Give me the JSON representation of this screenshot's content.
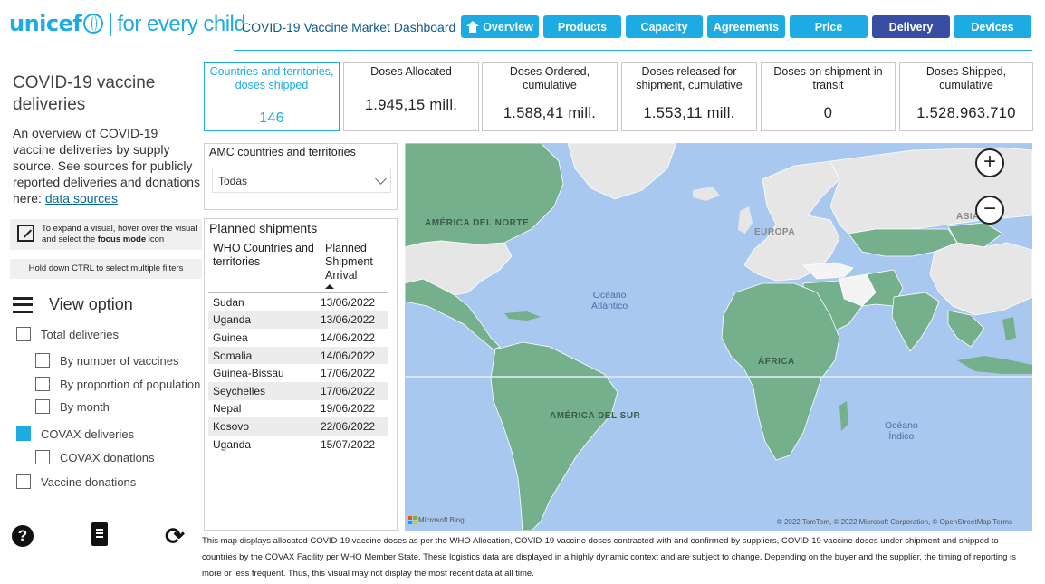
{
  "header": {
    "brand": "unicef",
    "tagline": "for every child",
    "dashboard_title": "COVID-19 Vaccine Market Dashboard",
    "nav": [
      {
        "label": "Overview",
        "active": false
      },
      {
        "label": "Products",
        "active": false
      },
      {
        "label": "Capacity",
        "active": false
      },
      {
        "label": "Agreements",
        "active": false
      },
      {
        "label": "Price",
        "active": false
      },
      {
        "label": "Delivery",
        "active": true
      },
      {
        "label": "Devices",
        "active": false
      }
    ]
  },
  "left": {
    "title": "COVID-19 vaccine deliveries",
    "description": "An overview of COVID-19 vaccine deliveries by supply source. See sources for publicly reported deliveries and donations here: ",
    "link_text": "data sources",
    "hint_focus_pre": "To expand a visual, hover over the visual and select the ",
    "hint_focus_bold": "focus mode",
    "hint_focus_post": " icon",
    "hint_ctrl": "Hold down CTRL to select multiple filters",
    "view_option_label": "View option",
    "options": [
      {
        "label": "Total deliveries",
        "checked": false
      },
      {
        "label": "By number of vaccines",
        "checked": false
      },
      {
        "label": "By proportion of population",
        "checked": false
      },
      {
        "label": "By month",
        "checked": false
      },
      {
        "label": "COVAX deliveries",
        "checked": true
      },
      {
        "label": "COVAX donations",
        "checked": false
      },
      {
        "label": "Vaccine donations",
        "checked": false
      }
    ]
  },
  "kpis": [
    {
      "label": "Countries and territories, doses shipped",
      "value": "146"
    },
    {
      "label": "Doses Allocated",
      "value": "1.945,15 mill."
    },
    {
      "label": "Doses Ordered, cumulative",
      "value": "1.588,41 mill."
    },
    {
      "label": "Doses released for shipment, cumulative",
      "value": "1.553,11 mill."
    },
    {
      "label": "Doses on shipment in transit",
      "value": "0"
    },
    {
      "label": "Doses Shipped, cumulative",
      "value": "1.528.963.710"
    }
  ],
  "amc": {
    "title": "AMC countries and territories",
    "selected": "Todas"
  },
  "shipments": {
    "title": "Planned shipments",
    "col1": "WHO Countries and territories",
    "col2": "Planned Shipment Arrival",
    "rows": [
      {
        "country": "Sudan",
        "date": "13/06/2022"
      },
      {
        "country": "Uganda",
        "date": "13/06/2022"
      },
      {
        "country": "Guinea",
        "date": "14/06/2022"
      },
      {
        "country": "Somalia",
        "date": "14/06/2022"
      },
      {
        "country": "Guinea-Bissau",
        "date": "17/06/2022"
      },
      {
        "country": "Seychelles",
        "date": "17/06/2022"
      },
      {
        "country": "Nepal",
        "date": "19/06/2022"
      },
      {
        "country": "Kosovo",
        "date": "22/06/2022"
      },
      {
        "country": "Uganda",
        "date": "15/07/2022"
      }
    ]
  },
  "map": {
    "labels": {
      "north_america": "AMÉRICA DEL NORTE",
      "europe": "EUROPA",
      "asia": "ASIA",
      "africa": "ÁFRICA",
      "south_america": "AMÉRICA DEL SUR",
      "atlantic_1": "Océano",
      "atlantic_2": "Atlántico",
      "indian_1": "Océano",
      "indian_2": "Índico"
    },
    "zoom_in": "+",
    "zoom_out": "−",
    "bing": "Microsoft Bing",
    "copyright": "© 2022 TomTom, © 2022 Microsoft Corporation, © OpenStreetMap  Terms",
    "colors": {
      "ocean": "#a9c8f0",
      "highlight": "#74b08c",
      "land": "#e6e6e6"
    }
  },
  "footnote": "This map displays allocated COVID-19 vaccine doses as per the WHO Allocation, COVID-19 vaccine doses contracted with and confirmed by suppliers, COVID-19 vaccine doses under shipment and shipped to countries by the COVAX Facility per WHO Member State. These logistics data are displayed in a highly dynamic context and are subject to change. Depending on the buyer and the supplier, the timing of reporting is more or less frequent. Thus, this visual may not display the most recent data at all time.",
  "colors": {
    "brand": "#1cabe2",
    "active_nav": "#374ea2"
  }
}
